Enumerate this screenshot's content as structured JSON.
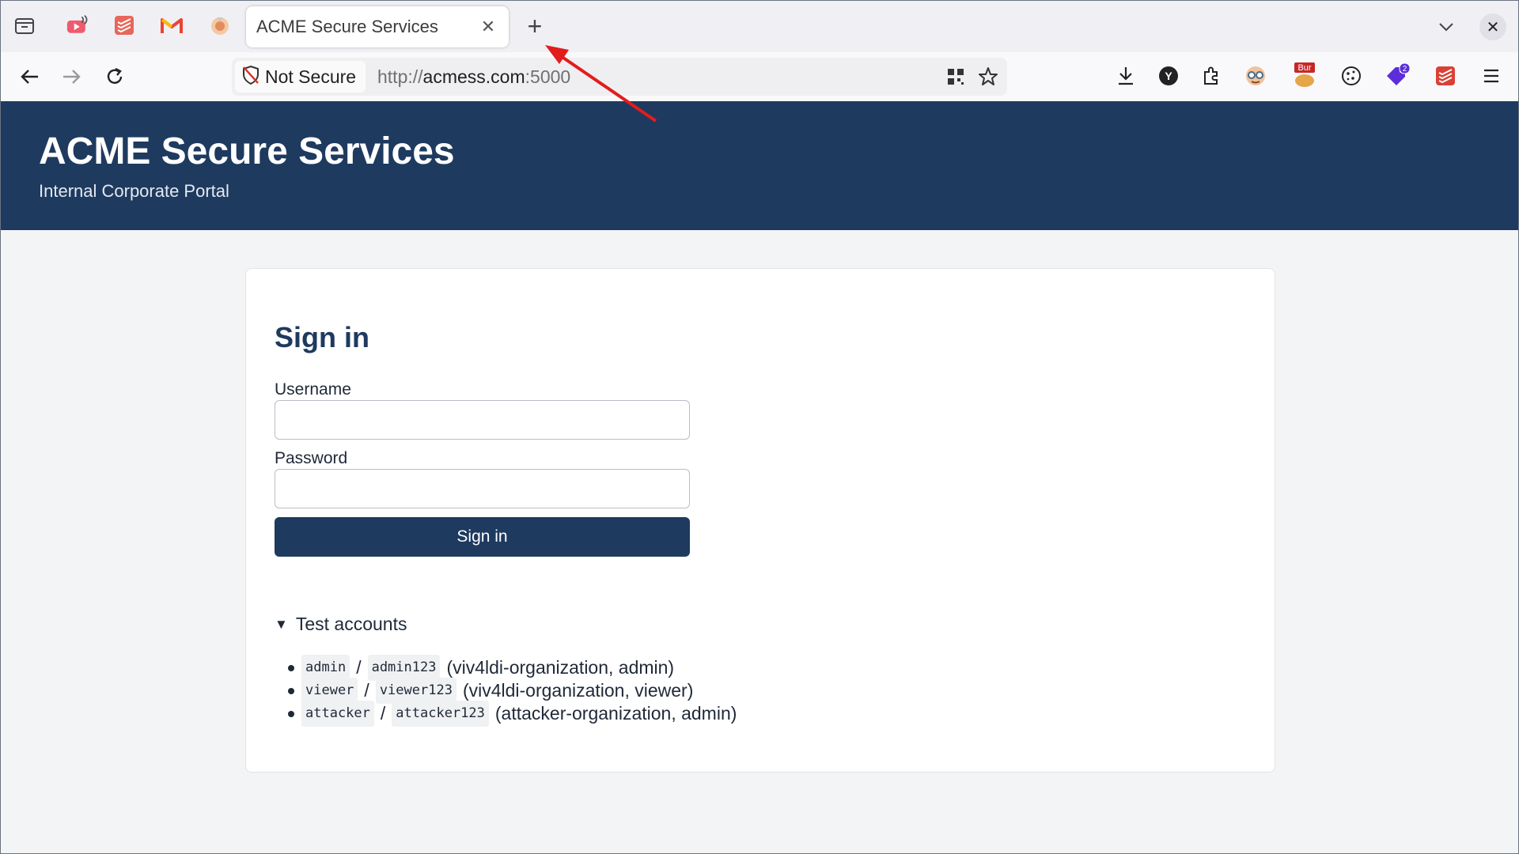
{
  "tabs": {
    "active_title": "ACME Secure Services",
    "new_tab_symbol": "+",
    "close_symbol": "✕",
    "pinned": [
      "youtube-audio-icon",
      "todoist-icon",
      "gmail-icon",
      "extension-tab-icon"
    ]
  },
  "navbar": {
    "not_secure_label": "Not Secure",
    "url_scheme": "http://",
    "url_host": "acmess.com",
    "url_port": ":5000"
  },
  "extensions": {
    "bur_badge": "Bur",
    "count_badge": "2",
    "y_letter": "Y"
  },
  "header": {
    "title": "ACME Secure Services",
    "subtitle": "Internal Corporate Portal"
  },
  "form": {
    "heading": "Sign in",
    "username_label": "Username",
    "username_value": "",
    "password_label": "Password",
    "password_value": "",
    "submit_label": "Sign in"
  },
  "test_accounts": {
    "summary": "Test accounts",
    "caret": "▼",
    "separator": "/",
    "items": [
      {
        "user": "admin",
        "pass": "admin123",
        "note": "(viv4ldi-organization, admin)"
      },
      {
        "user": "viewer",
        "pass": "viewer123",
        "note": "(viv4ldi-organization, viewer)"
      },
      {
        "user": "attacker",
        "pass": "attacker123",
        "note": "(attacker-organization, admin)"
      }
    ]
  },
  "colors": {
    "brand": "#1e3a5f",
    "annotation_arrow": "#e11d1d"
  }
}
